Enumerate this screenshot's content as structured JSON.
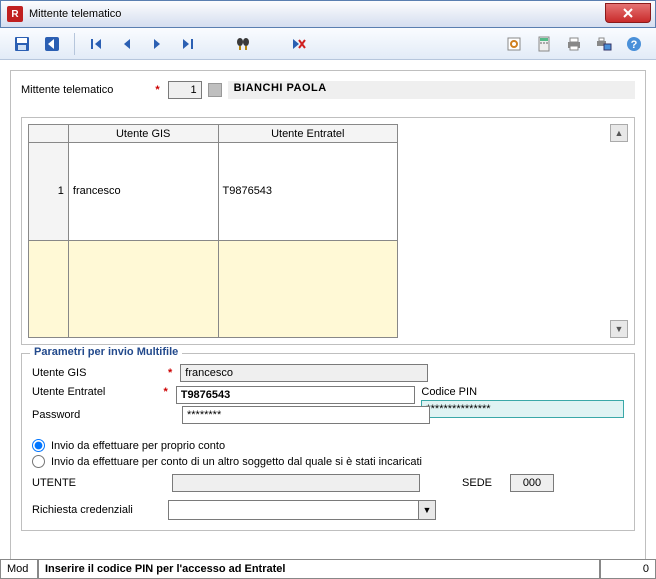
{
  "window": {
    "title": "Mittente telematico",
    "close_icon": "close"
  },
  "toolbar": {
    "save": "save-icon",
    "back": "back-icon",
    "first": "first-icon",
    "prev": "prev-icon",
    "next": "next-icon",
    "last": "last-icon",
    "find": "binoculars-icon",
    "cancel": "cancel-icon",
    "img1": "report-icon",
    "calc": "calculator-icon",
    "print": "printer-icon",
    "export": "printer-screen-icon",
    "help": "help-icon"
  },
  "header": {
    "label": "Mittente telematico",
    "number": "1",
    "name": "BIANCHI PAOLA"
  },
  "table": {
    "cols": [
      "",
      "Utente GIS",
      "Utente Entratel"
    ],
    "rows": [
      {
        "n": "1",
        "gis": "francesco",
        "entratel": "T9876543"
      },
      {
        "n": "",
        "gis": "",
        "entratel": ""
      }
    ]
  },
  "params": {
    "legend": "Parametri per invio Multifile",
    "labels": {
      "utente_gis": "Utente GIS",
      "utente_entratel": "Utente Entratel",
      "password": "Password",
      "codice_pin": "Codice PIN",
      "utente": "UTENTE",
      "sede": "SEDE",
      "richiesta": "Richiesta credenziali"
    },
    "values": {
      "utente_gis": "francesco",
      "utente_entratel": "T9876543",
      "password": "********",
      "codice_pin": "***************",
      "sede": "000"
    },
    "radios": {
      "r1": "Invio da effettuare per proprio conto",
      "r2": "Invio da effettuare per conto di un altro soggetto dal quale si è stati incaricati"
    }
  },
  "status": {
    "mode": "Mod",
    "message": "Inserire il codice PIN per l'accesso ad Entratel",
    "count": "0"
  }
}
